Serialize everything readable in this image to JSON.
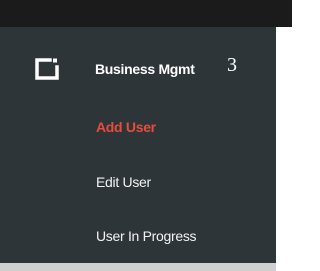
{
  "section": {
    "icon": "window-icon",
    "label": "Business Mgmt",
    "count": "3"
  },
  "submenu": {
    "items": [
      {
        "label": "Add User",
        "active": true
      },
      {
        "label": "Edit User",
        "active": false
      },
      {
        "label": "User In Progress",
        "active": false
      }
    ]
  },
  "colors": {
    "panel_bg": "#2e3538",
    "active_item": "#e74c3c",
    "text": "#f2f2f2"
  }
}
